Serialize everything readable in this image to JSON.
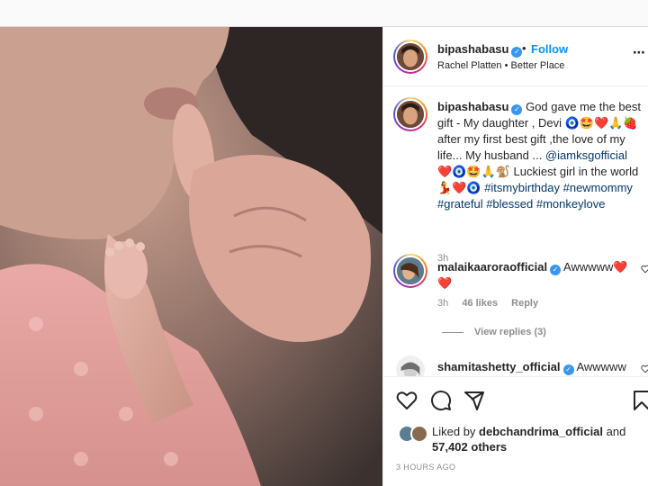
{
  "post": {
    "author": "bipashabasu",
    "follow_label": "Follow",
    "separator": "•",
    "audio": "Rachel Platten • Better Place",
    "more_icon": "⋯",
    "verified_icon": "✓"
  },
  "caption": {
    "author": "bipashabasu",
    "text_1": "God gave me the best gift - My daughter , Devi 🧿🤩❤️🙏🍓 after my first best gift ,the love of my life... My husband ...",
    "mention": "@iamksgofficial",
    "text_2": "❤️🧿🤩🙏🐒 Luckiest girl in the world 💃❤️🧿",
    "hashtags": "#itsmybirthday #newmommy #grateful #blessed #monkeylove",
    "time": "3h"
  },
  "comments": [
    {
      "author": "malaikaaroraofficial",
      "text": "Awwwww❤️❤️",
      "time": "3h",
      "likes": "46 likes",
      "reply": "Reply"
    },
    {
      "author": "shamitashetty_official",
      "text": "Awwwww"
    }
  ],
  "view_replies": "View replies (3)",
  "liked_by": {
    "prefix": "Liked by",
    "user": "debchandrima_official",
    "conj": "and",
    "others": "57,402 others"
  },
  "timestamp": "3 HOURS AGO",
  "icons": {
    "like": "heart-icon",
    "comment": "comment-icon",
    "share": "share-icon",
    "save": "bookmark-icon"
  },
  "colors": {
    "link": "#00376b",
    "follow": "#0095f6",
    "muted": "#8e8e8e",
    "verified": "#3897f0"
  }
}
